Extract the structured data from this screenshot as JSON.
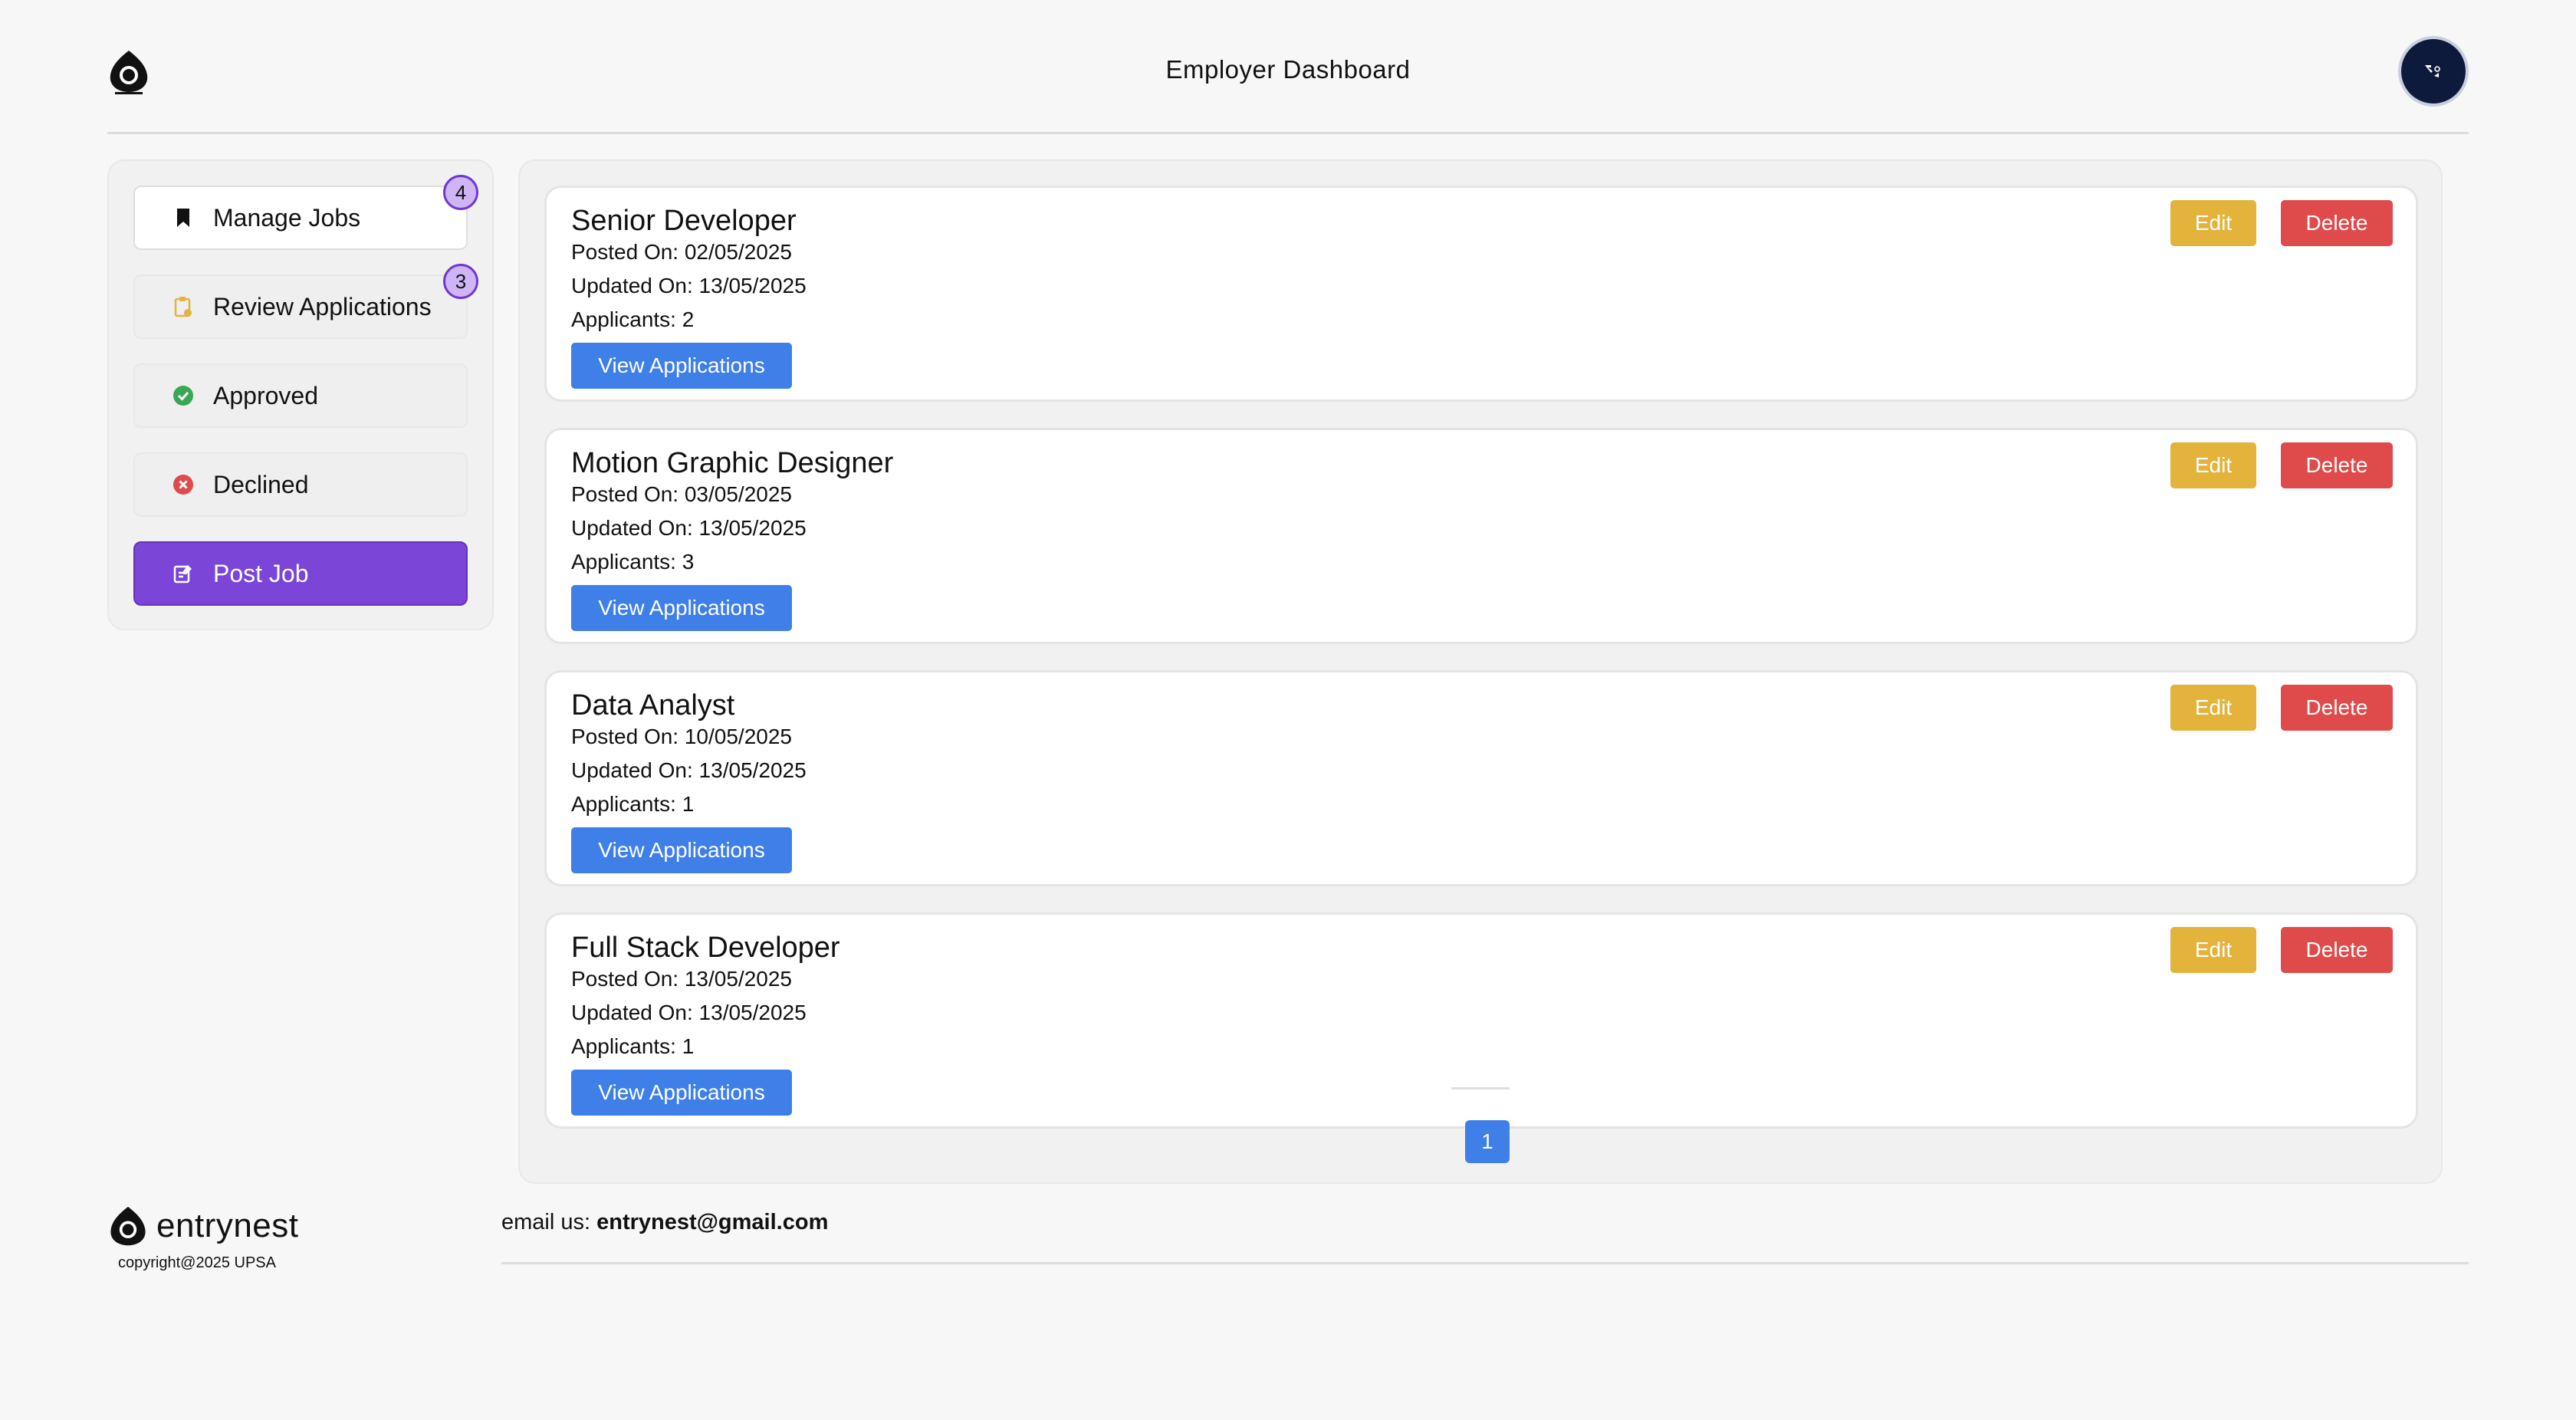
{
  "header": {
    "title": "Employer Dashboard"
  },
  "sidebar": {
    "items": [
      {
        "label": "Manage Jobs",
        "icon": "bookmark-icon",
        "badge": "4",
        "active": true
      },
      {
        "label": "Review Applications",
        "icon": "clipboard-icon",
        "badge": "3"
      },
      {
        "label": "Approved",
        "icon": "check-circle-icon"
      },
      {
        "label": "Declined",
        "icon": "x-circle-icon"
      },
      {
        "label": "Post Job",
        "icon": "edit-note-icon"
      }
    ]
  },
  "jobs": [
    {
      "title": "Senior Developer",
      "posted": "Posted On: 02/05/2025",
      "updated": "Updated On: 13/05/2025",
      "applicants": "Applicants: 2"
    },
    {
      "title": "Motion Graphic Designer",
      "posted": "Posted On: 03/05/2025",
      "updated": "Updated On: 13/05/2025",
      "applicants": "Applicants: 3"
    },
    {
      "title": "Data Analyst",
      "posted": "Posted On: 10/05/2025",
      "updated": "Updated On: 13/05/2025",
      "applicants": "Applicants: 1"
    },
    {
      "title": "Full Stack Developer",
      "posted": "Posted On: 13/05/2025",
      "updated": "Updated On: 13/05/2025",
      "applicants": "Applicants: 1"
    }
  ],
  "actions": {
    "view": "View Applications",
    "edit": "Edit",
    "delete": "Delete"
  },
  "pagination": {
    "current": "1"
  },
  "footer": {
    "brand": "entrynest",
    "copyright": "copyright@2025 UPSA",
    "email_prefix": "email us: ",
    "email": "entrynest@gmail.com"
  },
  "colors": {
    "primary_purple": "#7b45d8",
    "view_blue": "#3f7fe8",
    "edit_yellow": "#e3b33b",
    "delete_red": "#df4b4b",
    "avatar_navy": "#0e1a3c"
  }
}
